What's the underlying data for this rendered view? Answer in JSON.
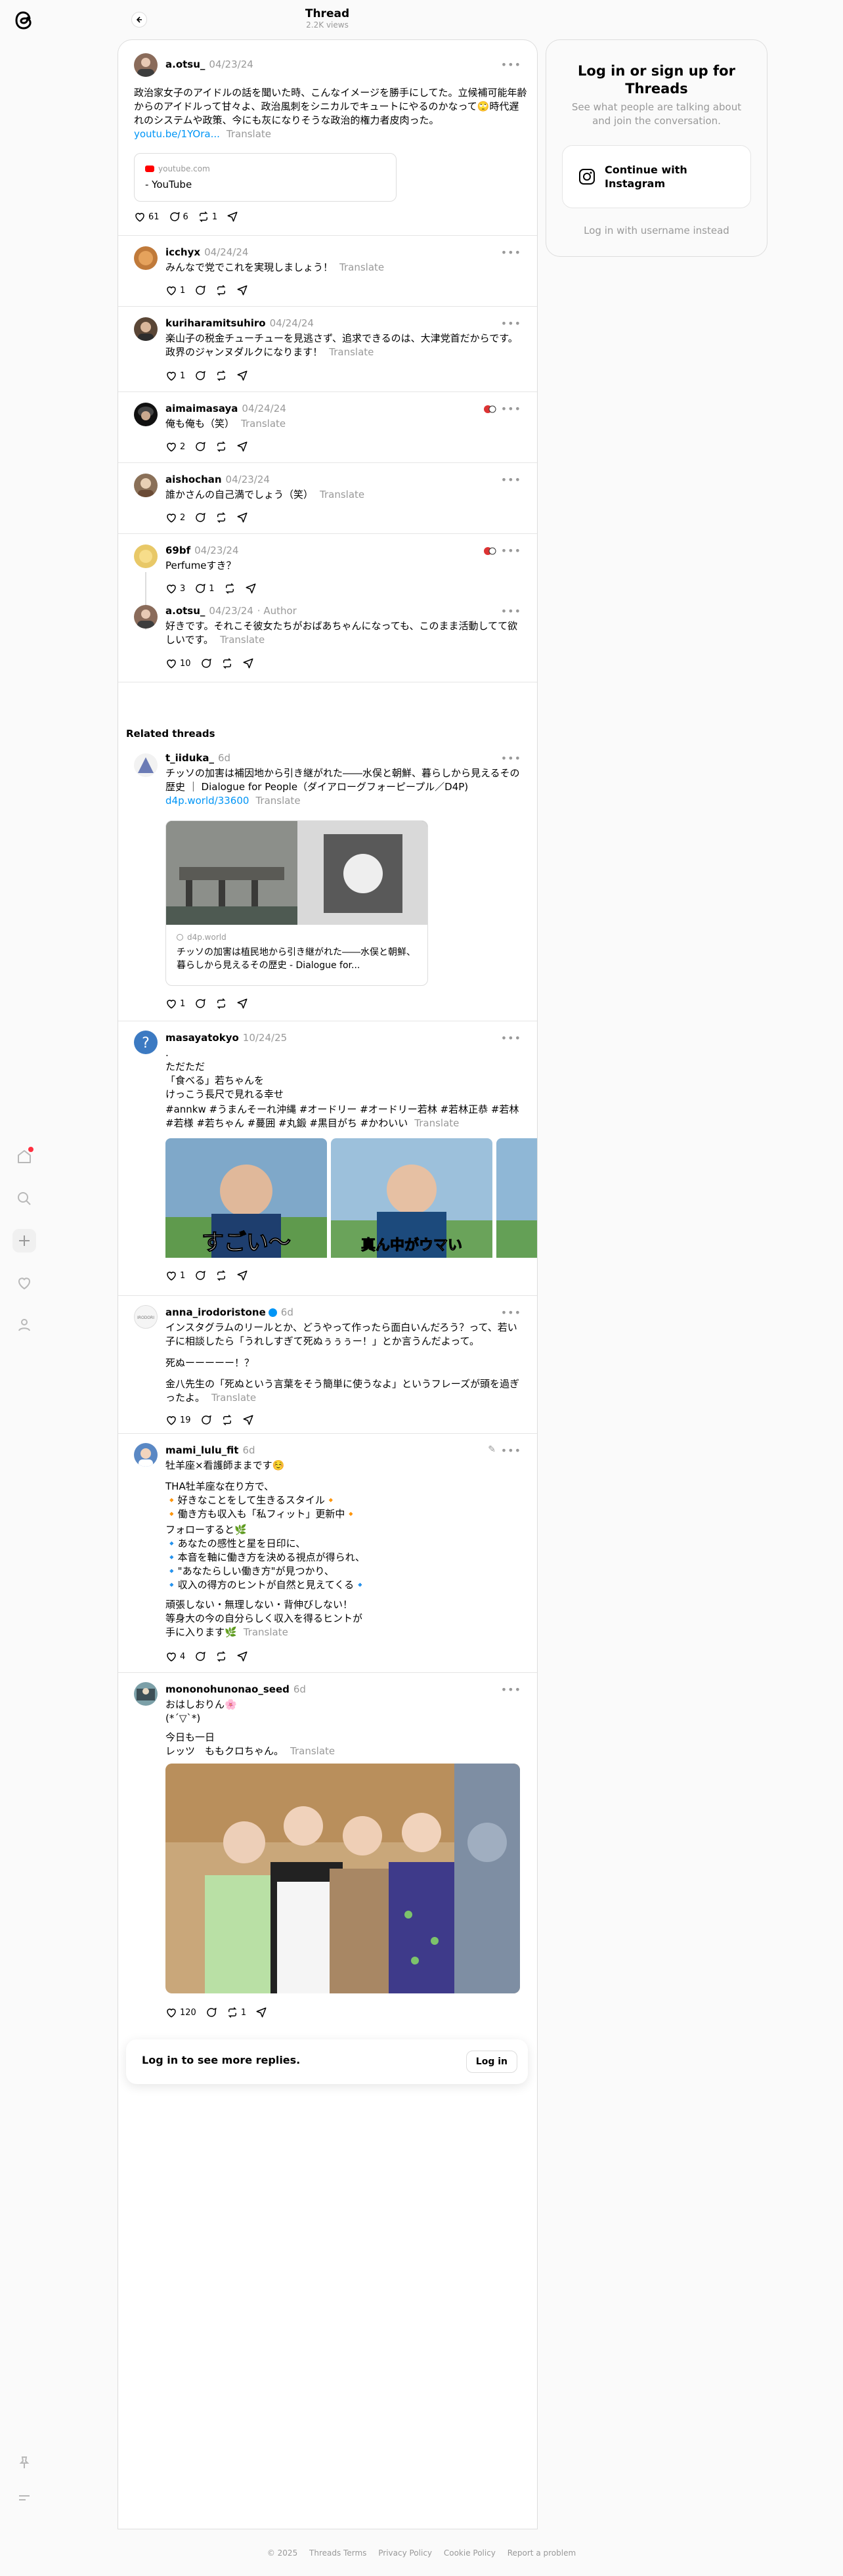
{
  "thread_header": {
    "title": "Thread",
    "views": "2.2K views"
  },
  "nav": {
    "icons": [
      "threads-logo",
      "home-icon",
      "search-icon",
      "create-icon",
      "heart-icon",
      "profile-icon",
      "pin-icon",
      "menu-icon"
    ]
  },
  "translate": "Translate",
  "main_post": {
    "user": "a.otsu_",
    "time": "04/23/24",
    "text": "政治家女子のアイドルの話を聞いた時、こんなイメージを勝手にしてた。立候補可能年齢からのアイドルって甘々よ、政治風刺をシニカルでキュートにやるのかなって🙄時代遅れのシステムや政策、今にも灰になりそうな政治的権力者皮肉った。",
    "link": "youtu.be/1YOra...",
    "card_domain": "youtube.com",
    "card_title": "- YouTube",
    "likes": "61",
    "replies": "6",
    "reposts": "1"
  },
  "replies": [
    {
      "user": "icchyx",
      "time": "04/24/24",
      "text": "みんなで党でこれを実現しましょう！",
      "likes": "1",
      "replies": "",
      "reposts": ""
    },
    {
      "user": "kuriharamitsuhiro",
      "time": "04/24/24",
      "text": "楽山子の税金チューチューを見逃さず、追求できるのは、大津党首だからです。政界のジャンヌダルクになります！",
      "likes": "1",
      "replies": "",
      "reposts": ""
    },
    {
      "user": "aimaimasaya",
      "time": "04/24/24",
      "text": "俺も俺も（笑）",
      "likes": "2",
      "replies": "",
      "reposts": ""
    },
    {
      "user": "aishochan",
      "time": "04/23/24",
      "text": "誰かさんの自己満でしょう（笑）",
      "likes": "2",
      "replies": "",
      "reposts": ""
    },
    {
      "user": "69bf",
      "time": "04/23/24",
      "text": "Perfumeすき？",
      "likes": "3",
      "replies": "1",
      "reposts": ""
    },
    {
      "user": "a.otsu_",
      "time": "04/23/24",
      "author": "· Author",
      "text": "好きです。それこそ彼女たちがおばあちゃんになっても、このまま活動してて欲しいです。",
      "likes": "10",
      "replies": "",
      "reposts": ""
    }
  ],
  "related_title": "Related threads",
  "related": [
    {
      "user": "t_iiduka_",
      "time": "6d",
      "text": "チッソの加害は補因地から引き継がれた――水俣と朝鮮、暮らしから見えるその歴史 ｜ Dialogue for People（ダイアローグフォーピープル／D4P)",
      "link": "d4p.world/33600",
      "card_domain": "d4p.world",
      "card_title": "チッソの加害は植民地から引き継がれた――水俣と朝鮮、暮らしから見えるその歴史 - Dialogue for...",
      "likes": "1",
      "replies": "",
      "reposts": ""
    },
    {
      "user": "masayatokyo",
      "time": "10/24/25",
      "text": ".\nただただ\n「食べる」若ちゃんを\nけっこう長尺で見れる幸せ",
      "tags": "#annkw #うまんそーれ沖縄 #オードリー #オードリー若林 #若林正恭 #若林 #若様 #若ちゃん #蔓囲 #丸鍛 #黒目がち #かわいい",
      "caption1": "すごい〜",
      "caption2": "真ん中がウマい",
      "likes": "1",
      "replies": "",
      "reposts": ""
    },
    {
      "user": "anna_irodoristone",
      "time": "6d",
      "text": "インスタグラムのリールとか、どうやって作ったら面白いんだろう？って、若い子に相談したら「うれしすぎて死ぬぅぅぅー！」とか言うんだよって。",
      "text2": "死ぬーーーーー！？",
      "text3": "金八先生の「死ぬという言葉をそう簡単に使うなよ」というフレーズが頭を過ぎったよ。",
      "likes": "19",
      "replies": "",
      "reposts": ""
    },
    {
      "user": "mami_lulu_fit",
      "time": "6d",
      "text": "牡羊座×看護師ままです☺️",
      "text2": "THA牡羊座な在り方で、\n🔸好きなことをして生きるスタイル🔸\n🔸働き方も収入も「私フィット」更新中🔸",
      "text3": "フォローすると🌿\n🔹あなたの感性と星を日印に、\n🔹本音を軸に働き方を決める視点が得られ、\n🔹\"あなたらしい働き方\"が見つかり、\n🔹収入の得方のヒントが自然と見えてくる🔹",
      "text4": "頑張しない・無理しない・背伸びしない！\n等身大の今の自分らしく収入を得るヒントが\n手に入ります🌿",
      "likes": "4",
      "replies": "",
      "reposts": ""
    },
    {
      "user": "mononohunonao_seed",
      "time": "6d",
      "text": "おはしおりん🌸\n(*´▽`*)",
      "text2": "今日も一日\nレッツ　ももクロちゃん。",
      "likes": "120",
      "replies": "",
      "reposts": "1"
    }
  ],
  "login_bar": {
    "text": "Log in to see more replies.",
    "button": "Log in"
  },
  "sidebar": {
    "title": "Log in or sign up for Threads",
    "subtitle": "See what people are talking about and join the conversation.",
    "ig_button": "Continue with Instagram",
    "username_link": "Log in with username instead"
  },
  "footer": [
    "© 2025",
    "Threads Terms",
    "Privacy Policy",
    "Cookie Policy",
    "Report a problem"
  ]
}
